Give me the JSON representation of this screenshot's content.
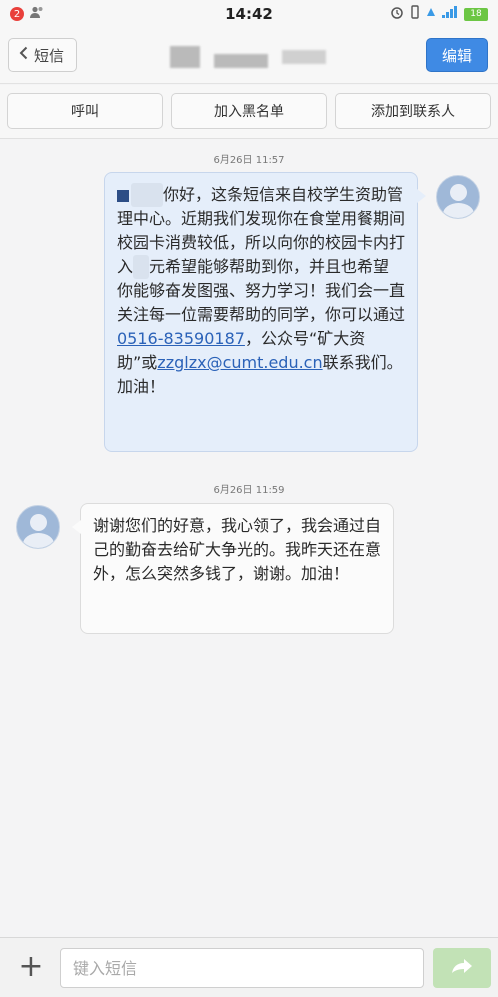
{
  "status_bar": {
    "notification_count": "2",
    "time": "14:42",
    "battery": "18"
  },
  "header": {
    "back_label": "短信",
    "edit_label": "编辑"
  },
  "actions": {
    "call": "呼叫",
    "blacklist": "加入黑名单",
    "add_contact": "添加到联系人"
  },
  "messages": [
    {
      "timestamp": "6月26日 11:57",
      "direction": "outgoing",
      "parts": {
        "greeting": "你好，这条短信来自校学生资助管理中心。近期我们发现你在食堂用餐期间校园卡消费较低，所以向你的校园卡内打入",
        "redacted_amount": "元",
        "mid": "希望能够帮助到你，并且也希望你能够奋发图强、努力学习！我们会一直关注每一位需要帮助的同学，你可以通过",
        "phone": "0516-83590187",
        "after_phone": "，公众号“矿大资助”或",
        "email": "zzglzx@cumt.edu.cn",
        "closing": "联系我们。加油！"
      }
    },
    {
      "timestamp": "6月26日 11:59",
      "direction": "incoming",
      "text": "谢谢您们的好意，我心领了，我会通过自己的勤奋去给矿大争光的。我昨天还在意外，怎么突然多钱了，谢谢。加油！"
    }
  ],
  "composer": {
    "placeholder": "键入短信"
  },
  "icons": {
    "back": "chevron-left-icon",
    "plus": "plus-icon",
    "send": "send-arrow-icon",
    "avatar": "default-avatar-icon"
  },
  "colors": {
    "accent": "#3f8ae4",
    "outgoing_bubble": "#e5eefa",
    "incoming_bubble": "#fbfbfb",
    "send_button": "#c2e2b6"
  }
}
